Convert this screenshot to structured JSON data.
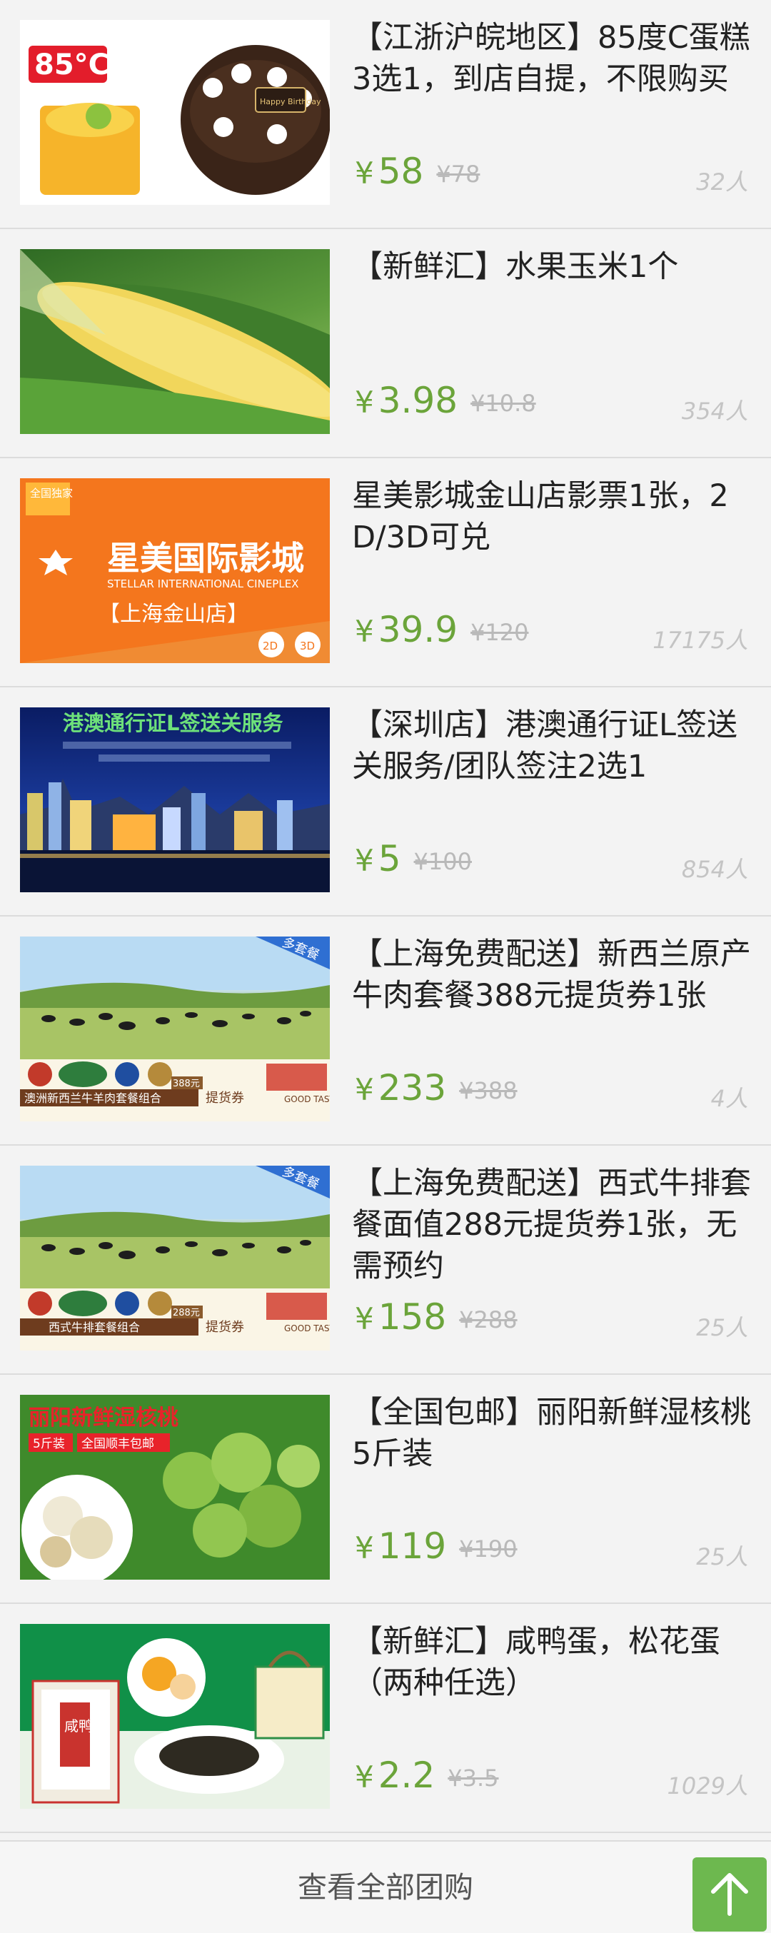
{
  "deals": [
    {
      "title": "【江浙沪皖地区】85度C蛋糕3选1，到店自提，不限购买",
      "price": "58",
      "original": "¥78",
      "count": "32人",
      "thumb": "cake-image",
      "thumb_text": [
        "85°C",
        "Happy Birthday"
      ]
    },
    {
      "title": "【新鲜汇】水果玉米1个",
      "price": "3.98",
      "original": "¥10.8",
      "count": "354人",
      "thumb": "corn-image"
    },
    {
      "title": "星美影城金山店影票1张，2D/3D可兑",
      "price": "39.9",
      "original": "¥120",
      "count": "17175人",
      "thumb": "stellar-cinema-image",
      "thumb_text": [
        "全国独家",
        "星美国际影城",
        "STELLAR INTERNATIONAL CINEPLEX",
        "【上海金山店】",
        "2D",
        "3D"
      ]
    },
    {
      "title": "【深圳店】港澳通行证L签送关服务/团队签注2选1",
      "price": "5",
      "original": "¥100",
      "count": "854人",
      "thumb": "hong-kong-image",
      "thumb_text": [
        "港澳通行证L签送关服务"
      ]
    },
    {
      "title": "【上海免费配送】新西兰原产牛肉套餐388元提货券1张",
      "price": "233",
      "original": "¥388",
      "count": "4人",
      "thumb": "beef-meadow-image",
      "thumb_text": [
        "多套餐",
        "澳洲新西兰牛羊肉套餐组合",
        "388元",
        "提货券",
        "GOOD TASTE"
      ]
    },
    {
      "title": "【上海免费配送】西式牛排套餐面值288元提货券1张，无需预约",
      "price": "158",
      "original": "¥288",
      "count": "25人",
      "thumb": "steak-meadow-image",
      "thumb_text": [
        "多套餐",
        "西式牛排套餐组合",
        "288元",
        "提货券",
        "GOOD TASTE"
      ]
    },
    {
      "title": "【全国包邮】丽阳新鲜湿核桃5斤装",
      "price": "119",
      "original": "¥190",
      "count": "25人",
      "thumb": "walnut-image",
      "thumb_text": [
        "丽阳新鲜湿核桃",
        "5斤装",
        "全国顺丰包邮"
      ]
    },
    {
      "title": "【新鲜汇】咸鸭蛋，松花蛋（两种任选）",
      "price": "2.2",
      "original": "¥3.5",
      "count": "1029人",
      "thumb": "egg-image",
      "thumb_text": [
        "咸鸭"
      ]
    }
  ],
  "currency": "¥",
  "footer": {
    "view_all": "查看全部团购"
  },
  "colors": {
    "price": "#6ba43a",
    "accent": "#6db84f",
    "background": "#f3f3f3"
  },
  "icons": {
    "back_to_top": "arrow-up-icon"
  }
}
